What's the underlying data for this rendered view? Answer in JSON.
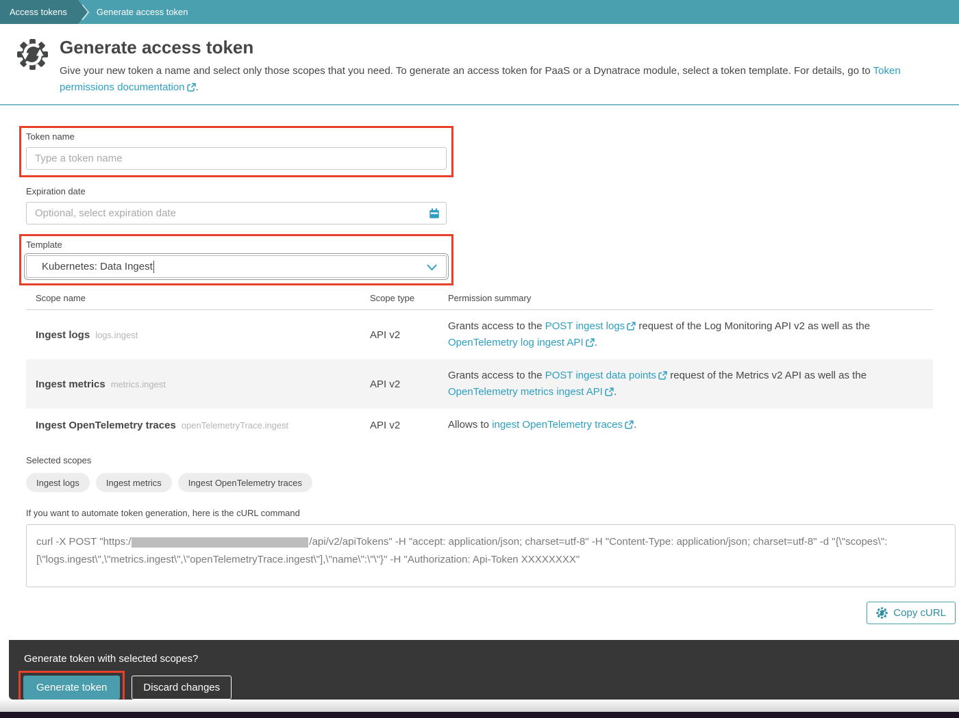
{
  "colors": {
    "accent_teal": "#4a9fae",
    "breadcrumb_dark": "#3a7a85",
    "breadcrumb_light": "#4aa0af",
    "link_teal": "#2d9fc0",
    "annotation_red": "#e8402a",
    "bottom_bar_dark": "#373737",
    "row_alt_gray": "#f4f4f4"
  },
  "icons": {
    "header": "gear-sync-icon",
    "breadcrumb_sep": "chevron-right-icon",
    "calendar": "calendar-icon",
    "combo_chevron": "chevron-down-icon",
    "external_link": "external-link-icon",
    "copy": "gear-sync-icon"
  },
  "breadcrumb": {
    "items": [
      {
        "label": "Access tokens"
      },
      {
        "label": "Generate access token"
      }
    ]
  },
  "header": {
    "title": "Generate access token",
    "description_before": "Give your new token a name and select only those scopes that you need. To generate an access token for PaaS or a Dynatrace module, select a token template. For details, go to ",
    "description_link": "Token permissions documentation",
    "description_after": "."
  },
  "form": {
    "token_name": {
      "label": "Token name",
      "placeholder": "Type a token name",
      "value": ""
    },
    "expiration": {
      "label": "Expiration date",
      "placeholder": "Optional, select expiration date",
      "value": ""
    },
    "template": {
      "label": "Template",
      "value": "Kubernetes: Data Ingest"
    }
  },
  "scopes_table": {
    "columns": [
      "Scope name",
      "Scope type",
      "Permission summary"
    ],
    "rows": [
      {
        "name": "Ingest logs",
        "code": "logs.ingest",
        "type": "API v2",
        "summary": [
          {
            "t": "Grants access to the "
          },
          {
            "l": "POST ingest logs"
          },
          {
            "t": " request of the Log Monitoring API v2 as well as the "
          },
          {
            "l": "OpenTelemetry log ingest API"
          },
          {
            "t": "."
          }
        ]
      },
      {
        "name": "Ingest metrics",
        "code": "metrics.ingest",
        "type": "API v2",
        "summary": [
          {
            "t": "Grants access to the "
          },
          {
            "l": "POST ingest data points"
          },
          {
            "t": " request of the Metrics v2 API as well as the "
          },
          {
            "l": "OpenTelemetry metrics ingest API"
          },
          {
            "t": "."
          }
        ]
      },
      {
        "name": "Ingest OpenTelemetry traces",
        "code": "openTelemetryTrace.ingest",
        "type": "API v2",
        "summary": [
          {
            "t": "Allows to "
          },
          {
            "l": "ingest OpenTelemetry traces"
          },
          {
            "t": "."
          }
        ]
      }
    ]
  },
  "selected_scopes": {
    "label": "Selected scopes",
    "chips": [
      "Ingest logs",
      "Ingest metrics",
      "Ingest OpenTelemetry traces"
    ]
  },
  "curl": {
    "intro": "If you want to automate token generation, here is the cURL command",
    "part1": "curl -X POST \"https:/",
    "part2": "/api/v2/apiTokens\" -H \"accept: application/json; charset=utf-8\" -H \"Content-Type: application/json; charset=utf-8\" -d \"{\\\"scopes\\\": [\\\"logs.ingest\\\",\\\"metrics.ingest\\\",\\\"openTelemetryTrace.ingest\\\"],\\\"name\\\":\\\"\\\"}\" -H \"Authorization: Api-Token XXXXXXXX\"",
    "copy_label": "Copy cURL"
  },
  "bottom_bar": {
    "question": "Generate token with selected scopes?",
    "generate_label": "Generate token",
    "discard_label": "Discard changes"
  }
}
